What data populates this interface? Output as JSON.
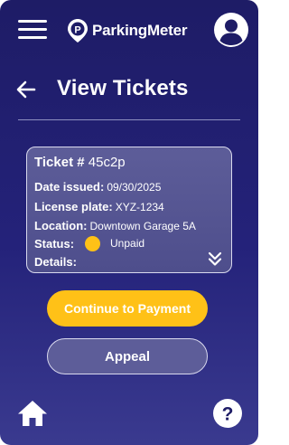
{
  "header": {
    "app_name": "ParkingMeter",
    "menu_icon": "hamburger-menu-icon",
    "logo_icon": "parking-pin-icon",
    "profile_icon": "user-profile-icon"
  },
  "page": {
    "title": "View Tickets",
    "back_icon": "arrow-left-icon"
  },
  "ticket": {
    "number_label": "Ticket #",
    "number": "45c2p",
    "date_label": "Date issued:",
    "date": "09/30/2025",
    "plate_label": "License plate:",
    "plate": "XYZ-1234",
    "location_label": "Location:",
    "location": "Downtown Garage 5A",
    "status_label": "Status:",
    "status": "Unpaid",
    "status_color": "#ffc117",
    "details_label": "Details:",
    "expand_icon": "double-chevron-down-icon"
  },
  "actions": {
    "pay_label": "Continue to Payment",
    "appeal_label": "Appeal"
  },
  "footer": {
    "home_icon": "home-icon",
    "help_icon": "help-icon"
  },
  "colors": {
    "background_top": "#1e1c66",
    "background_bottom": "#3a3a8f",
    "accent": "#ffc117",
    "card": "#5d5d99"
  }
}
